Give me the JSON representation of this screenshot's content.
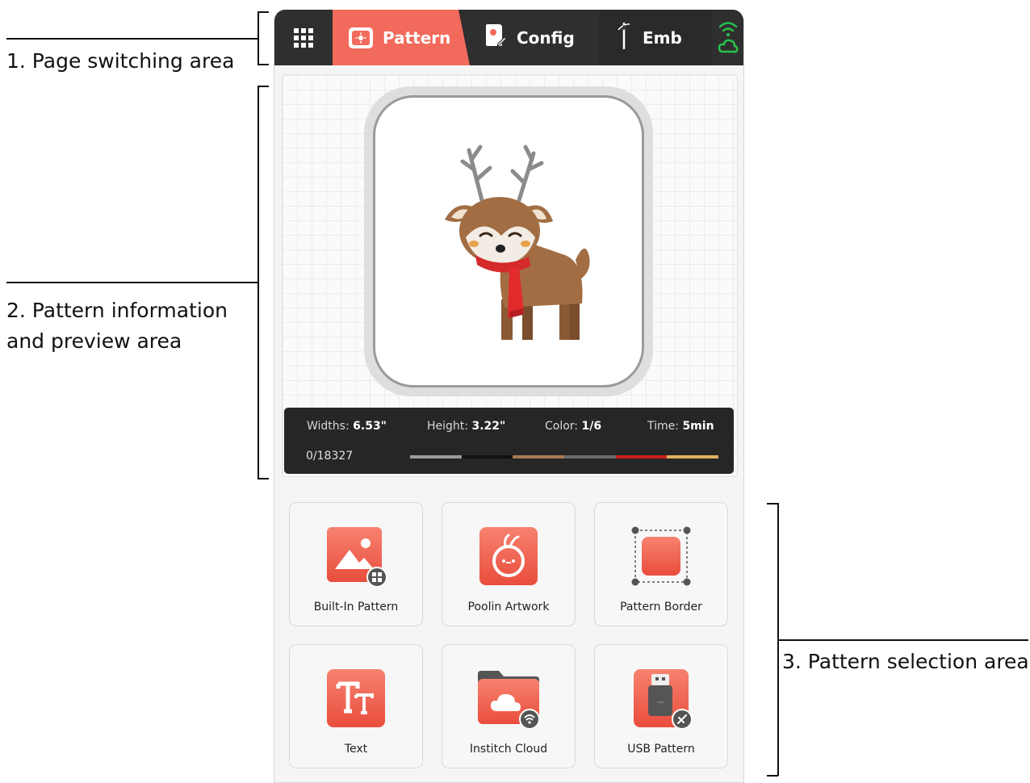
{
  "annotations": {
    "page_switching": "1. Page switching area",
    "preview_line1": "2. Pattern information",
    "preview_line2": "and preview area",
    "selection": "3. Pattern selection area"
  },
  "topbar": {
    "tabs": [
      {
        "label": "Pattern",
        "active": true
      },
      {
        "label": "Config",
        "active": false
      },
      {
        "label": "Emb",
        "active": false
      }
    ],
    "menu_icon": "grid-icon",
    "connection_icon": "wifi-cloud-icon"
  },
  "pattern_info": {
    "width_label": "Widths:",
    "width_value": "6.53\"",
    "height_label": "Height:",
    "height_value": "3.22\"",
    "color_label": "Color:",
    "color_value": "1/6",
    "time_label": "Time:",
    "time_value": "5min",
    "stitch_count": "0/18327",
    "thread_colors": [
      "#9c9c9c",
      "#111111",
      "#a87a52",
      "#6b6b6b",
      "#c8201f",
      "#e0b060"
    ]
  },
  "tiles": [
    {
      "label": "Built-In Pattern",
      "icon": "image-icon"
    },
    {
      "label": "Poolin Artwork",
      "icon": "poolin-icon"
    },
    {
      "label": "Pattern Border",
      "icon": "border-icon"
    },
    {
      "label": "Text",
      "icon": "text-icon"
    },
    {
      "label": "Institch Cloud",
      "icon": "cloud-folder-icon"
    },
    {
      "label": "USB Pattern",
      "icon": "usb-icon"
    }
  ],
  "colors": {
    "accent": "#f26a5b",
    "topbar": "#2f2f2f",
    "wifi_green": "#27c24c"
  }
}
